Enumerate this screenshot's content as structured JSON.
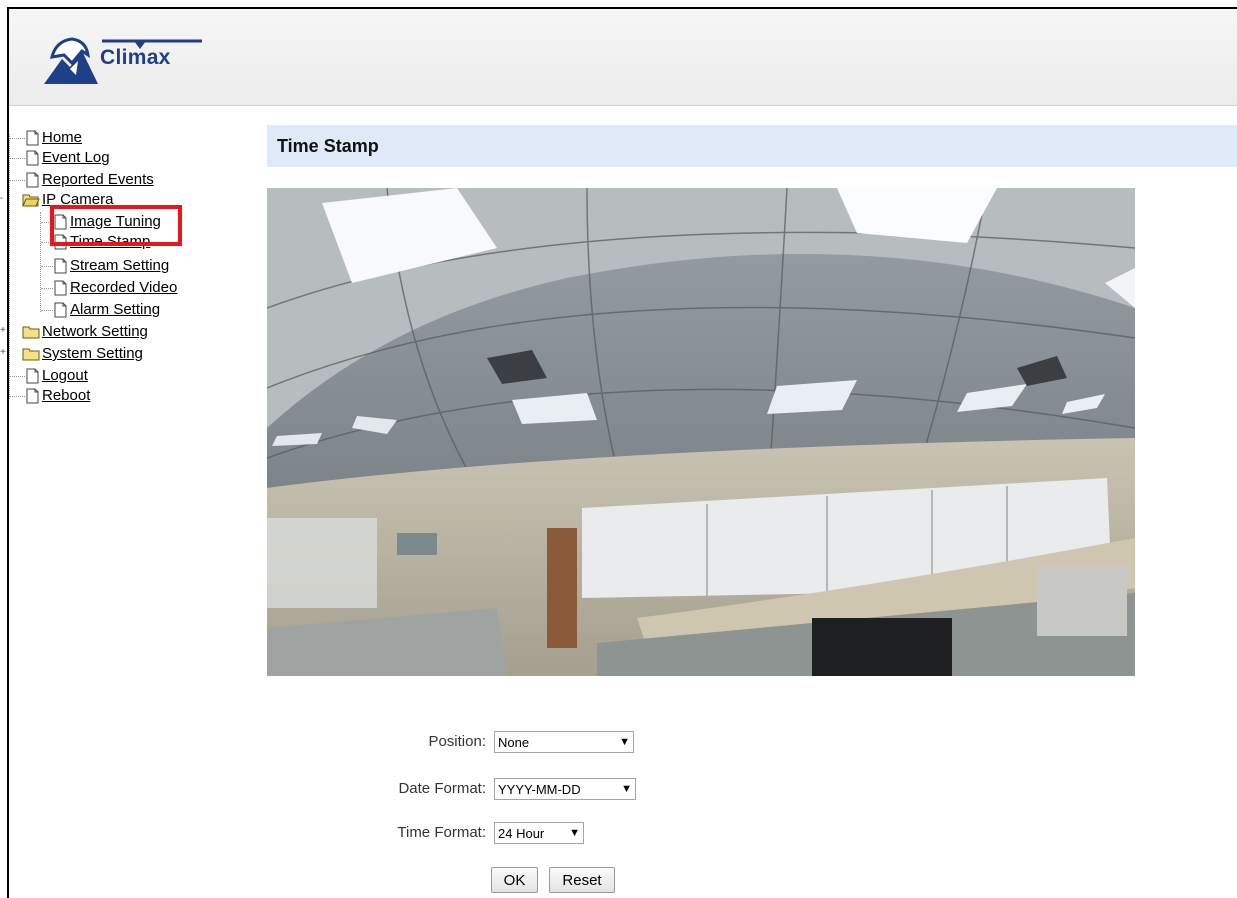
{
  "header": {
    "logo_text": "Climax"
  },
  "nav": {
    "home": "Home",
    "event_log": "Event Log",
    "reported_events": "Reported Events",
    "ip_camera": "IP Camera",
    "image_tuning": "Image Tuning",
    "time_stamp": "Time Stamp",
    "stream_setting": "Stream Setting",
    "recorded_video": "Recorded Video",
    "alarm_setting": "Alarm Setting",
    "network_setting": "Network Setting",
    "system_setting": "System Setting",
    "logout": "Logout",
    "reboot": "Reboot"
  },
  "page": {
    "title": "Time Stamp"
  },
  "form": {
    "position_label": "Position:",
    "position_value": "None",
    "date_format_label": "Date Format:",
    "date_format_value": "YYYY-MM-DD",
    "time_format_label": "Time Format:",
    "time_format_value": "24 Hour",
    "ok_label": "OK",
    "reset_label": "Reset"
  },
  "colors": {
    "accent_highlight": "#e8151b",
    "title_bar_bg": "#dfe9f7",
    "brand": "#1f3f86"
  },
  "icons": {
    "page": "page-icon",
    "folder": "folder-icon",
    "expand": "expand-icon"
  }
}
